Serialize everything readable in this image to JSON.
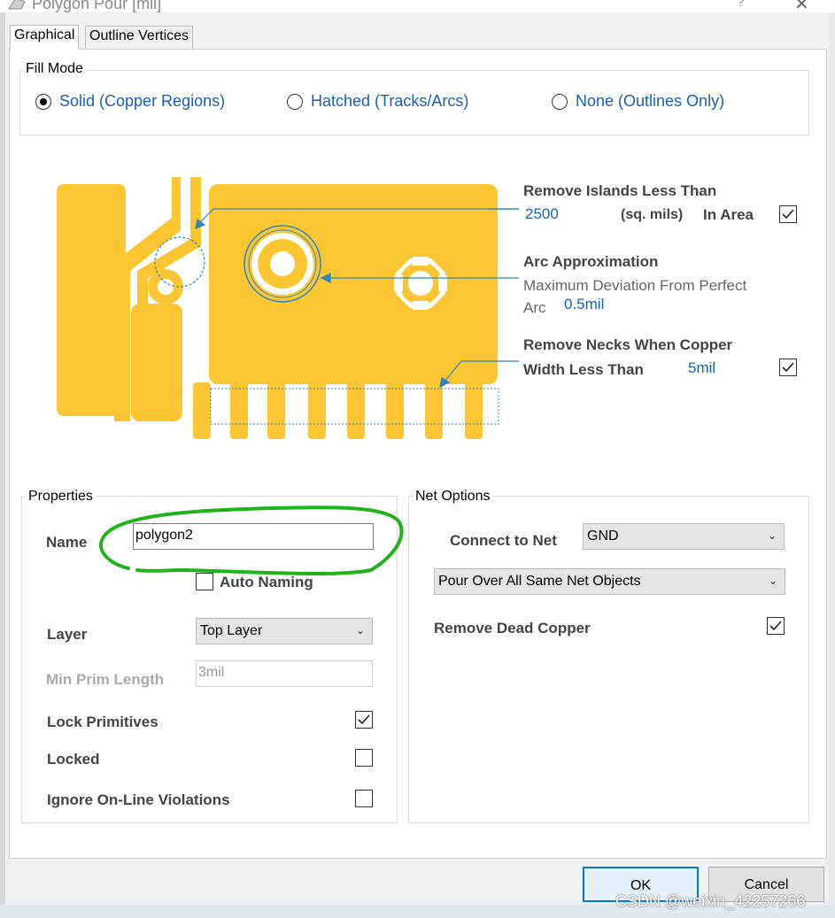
{
  "window": {
    "title": "Polygon Pour [mil]",
    "help_glyph": "?",
    "close_glyph": "✕"
  },
  "tabs": [
    {
      "label": "Graphical",
      "active": true
    },
    {
      "label": "Outline Vertices",
      "active": false
    }
  ],
  "fill_mode": {
    "legend": "Fill Mode",
    "options": [
      {
        "label": "Solid (Copper Regions)",
        "selected": true
      },
      {
        "label": "Hatched (Tracks/Arcs)",
        "selected": false
      },
      {
        "label": "None (Outlines Only)",
        "selected": false
      }
    ]
  },
  "graphic": {
    "copper_color": "#fcc633",
    "callout_color": "#2e86c1",
    "remove_islands": {
      "label": "Remove Islands Less Than",
      "value": "2500",
      "unit": "(sq. mils)",
      "area_label": "In Area",
      "checked": true
    },
    "arc_approx": {
      "label": "Arc Approximation",
      "desc_line1": "Maximum Deviation From Perfect",
      "desc_line2": "Arc",
      "value": "0.5mil"
    },
    "remove_necks": {
      "label_line1": "Remove Necks When Copper",
      "label_line2": "Width Less Than",
      "value": "5mil",
      "checked": true
    }
  },
  "properties": {
    "legend": "Properties",
    "name_label": "Name",
    "name_value": "polygon2",
    "auto_naming_label": "Auto Naming",
    "auto_naming_checked": false,
    "layer_label": "Layer",
    "layer_value": "Top Layer",
    "min_prim_label": "Min Prim Length",
    "min_prim_value": "3mil",
    "lock_primitives_label": "Lock Primitives",
    "lock_primitives_checked": true,
    "locked_label": "Locked",
    "locked_checked": false,
    "ignore_label": "Ignore On-Line Violations",
    "ignore_checked": false,
    "annotation_color": "#22b21b"
  },
  "net_options": {
    "legend": "Net Options",
    "connect_label": "Connect to Net",
    "connect_value": "GND",
    "pour_value": "Pour Over All Same Net Objects",
    "remove_dead_label": "Remove Dead Copper",
    "remove_dead_checked": true
  },
  "buttons": {
    "ok": "OK",
    "cancel": "Cancel"
  },
  "watermark": "CSDN @weixin_42257266"
}
